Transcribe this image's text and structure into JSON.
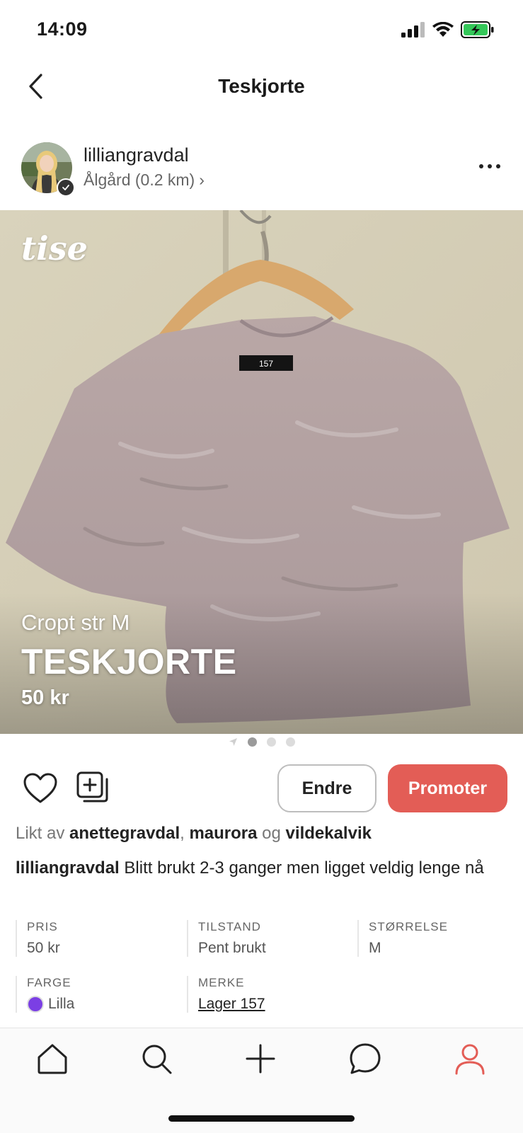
{
  "status_bar": {
    "time": "14:09"
  },
  "header": {
    "title": "Teskjorte"
  },
  "seller": {
    "username": "lilliangravdal",
    "location": "Ålgård (0.2 km)",
    "location_chevron": "›"
  },
  "photo": {
    "watermark": "tise",
    "subtitle": "Cropt str M",
    "title": "TESKJORTE",
    "price": "50 kr",
    "page_count": 3,
    "active_index": 0
  },
  "actions": {
    "edit_label": "Endre",
    "promote_label": "Promoter"
  },
  "likes": {
    "prefix": "Likt av",
    "user1": "anettegravdal",
    "separator": ",",
    "user2": "maurora",
    "conjunction": "og",
    "user3": "vildekalvik"
  },
  "description": {
    "author": "lilliangravdal",
    "text": "Blitt brukt 2-3 ganger men ligget veldig lenge nå"
  },
  "attributes": {
    "price": {
      "label": "PRIS",
      "value": "50 kr"
    },
    "condition": {
      "label": "TILSTAND",
      "value": "Pent brukt"
    },
    "size": {
      "label": "STØRRELSE",
      "value": "M"
    },
    "color": {
      "label": "FARGE",
      "value": "Lilla",
      "swatch": "#7b3fe4"
    },
    "brand": {
      "label": "MERKE",
      "value": "Lager 157"
    }
  },
  "tabbar": {
    "items": [
      "home-icon",
      "search-icon",
      "plus-icon",
      "chat-icon",
      "profile-icon"
    ],
    "active_color": "#e35d56"
  }
}
